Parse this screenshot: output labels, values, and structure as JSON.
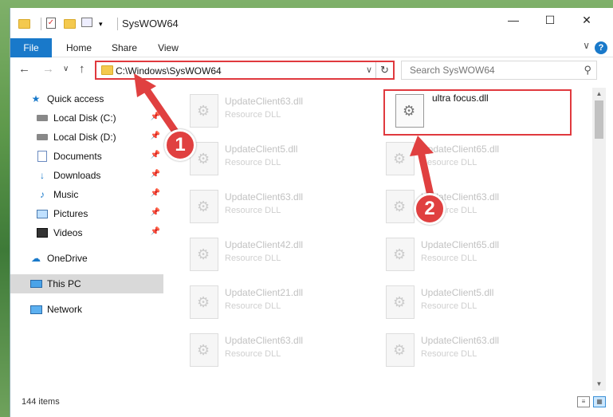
{
  "window": {
    "title": "SysWOW64"
  },
  "window_controls": {
    "minimize": "—",
    "maximize": "☐",
    "close": "✕"
  },
  "ribbon": {
    "tabs": [
      "File",
      "Home",
      "Share",
      "View"
    ],
    "help": "?",
    "collapse": "∨"
  },
  "nav": {
    "back": "←",
    "forward": "→",
    "recent": "∨",
    "up": "↑"
  },
  "address": {
    "path": "C:\\Windows\\SysWOW64",
    "dropdown": "∨",
    "refresh": "↻"
  },
  "search": {
    "placeholder": "Search SysWOW64",
    "icon": "⚲"
  },
  "sidebar": {
    "items": [
      {
        "label": "Quick access",
        "icon": "star-icon",
        "pinned": false
      },
      {
        "label": "Local Disk (C:)",
        "icon": "disk-icon",
        "pinned": true
      },
      {
        "label": "Local Disk (D:)",
        "icon": "disk-icon",
        "pinned": true
      },
      {
        "label": "Documents",
        "icon": "documents-icon",
        "pinned": true
      },
      {
        "label": "Downloads",
        "icon": "download-arrow-icon",
        "pinned": true
      },
      {
        "label": "Music",
        "icon": "music-note-icon",
        "pinned": true
      },
      {
        "label": "Pictures",
        "icon": "pictures-icon",
        "pinned": true
      },
      {
        "label": "Videos",
        "icon": "film-icon",
        "pinned": true
      },
      {
        "label": "OneDrive",
        "icon": "cloud-icon",
        "pinned": false
      },
      {
        "label": "This PC",
        "icon": "computer-icon",
        "pinned": false,
        "selected": true
      },
      {
        "label": "Network",
        "icon": "network-icon",
        "pinned": false
      }
    ]
  },
  "files": [
    {
      "name": "UpdateClient63.dll",
      "type": "Resource DLL",
      "faded": true
    },
    {
      "name": "ultra focus.dll",
      "type": "",
      "faded": false
    },
    {
      "name": "UpdateClient5.dll",
      "type": "Resource DLL",
      "faded": true
    },
    {
      "name": "UpdateClient65.dll",
      "type": "Resource DLL",
      "faded": true
    },
    {
      "name": "UpdateClient63.dll",
      "type": "Resource DLL",
      "faded": true
    },
    {
      "name": "UpdateClient63.dll",
      "type": "Resource DLL",
      "faded": true
    },
    {
      "name": "UpdateClient42.dll",
      "type": "Resource DLL",
      "faded": true
    },
    {
      "name": "UpdateClient65.dll",
      "type": "Resource DLL",
      "faded": true
    },
    {
      "name": "UpdateClient21.dll",
      "type": "Resource DLL",
      "faded": true
    },
    {
      "name": "UpdateClient5.dll",
      "type": "Resource DLL",
      "faded": true
    },
    {
      "name": "UpdateClient63.dll",
      "type": "Resource DLL",
      "faded": true
    },
    {
      "name": "UpdateClient63.dll",
      "type": "Resource DLL",
      "faded": true
    }
  ],
  "status": {
    "item_count": "144 items"
  },
  "callouts": {
    "step1": "1",
    "step2": "2"
  },
  "colors": {
    "accent": "#1979ca",
    "annotation_red": "#e0393e",
    "selected_bg": "#d9d9d9"
  }
}
